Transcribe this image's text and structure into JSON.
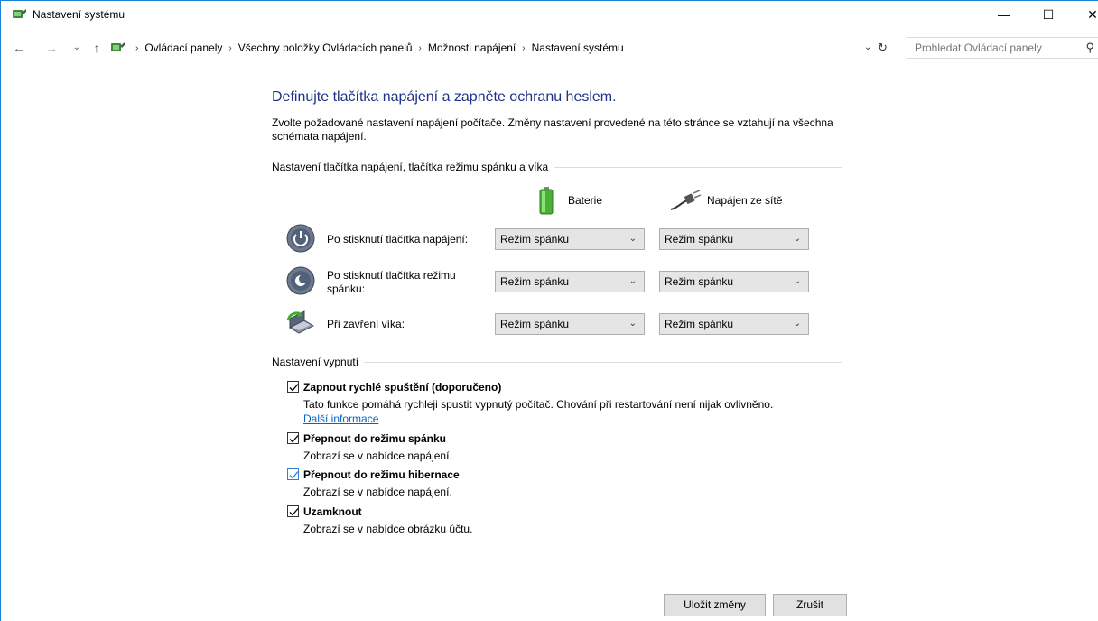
{
  "window": {
    "title": "Nastavení systému",
    "minimize_glyph": "—",
    "maximize_glyph": "☐",
    "close_glyph": "✕"
  },
  "address": {
    "back_glyph": "←",
    "forward_glyph": "→",
    "history_glyph": "⌄",
    "up_glyph": "↑",
    "breadcrumbs": [
      "Ovládací panely",
      "Všechny položky Ovládacích panelů",
      "Možnosti napájení",
      "Nastavení systému"
    ],
    "separator": "›",
    "dropdown_glyph": "⌄",
    "refresh_glyph": "↻",
    "search_placeholder": "Prohledat Ovládací panely",
    "search_glyph": "⚲"
  },
  "content": {
    "heading": "Definujte tlačítka napájení a zapněte ochranu heslem.",
    "description": "Zvolte požadované nastavení napájení počítače. Změny nastavení provedené na této stránce se vztahují na všechna schémata napájení.",
    "group_buttons": "Nastavení tlačítka napájení, tlačítka režimu spánku a víka",
    "col_battery": "Baterie",
    "col_plugged": "Napájen ze sítě",
    "rows": [
      {
        "label": "Po stisknutí tlačítka napájení:",
        "battery": "Režim spánku",
        "plugged": "Režim spánku"
      },
      {
        "label": "Po stisknutí tlačítka režimu spánku:",
        "battery": "Režim spánku",
        "plugged": "Režim spánku"
      },
      {
        "label": "Při zavření víka:",
        "battery": "Režim spánku",
        "plugged": "Režim spánku"
      }
    ],
    "chevron_glyph": "⌄",
    "group_shutdown": "Nastavení vypnutí",
    "options": [
      {
        "title": "Zapnout rychlé spuštění (doporučeno)",
        "desc": "Tato funkce pomáhá rychleji spustit vypnutý počítač. Chování při restartování není nijak ovlivněno.",
        "link": "Další informace",
        "checked": true
      },
      {
        "title": "Přepnout do režimu spánku",
        "desc": "Zobrazí se v nabídce napájení.",
        "checked": true
      },
      {
        "title": "Přepnout do režimu hibernace",
        "desc": "Zobrazí se v nabídce napájení.",
        "checked": true
      },
      {
        "title": "Uzamknout",
        "desc": "Zobrazí se v nabídce obrázku účtu.",
        "checked": true
      }
    ]
  },
  "footer": {
    "save_label": "Uložit změny",
    "cancel_label": "Zrušit"
  },
  "colors": {
    "heading": "#1e3287",
    "link": "#0066cc",
    "window_border": "#1883d7",
    "checkbox_focus": "#2e7fd4"
  }
}
